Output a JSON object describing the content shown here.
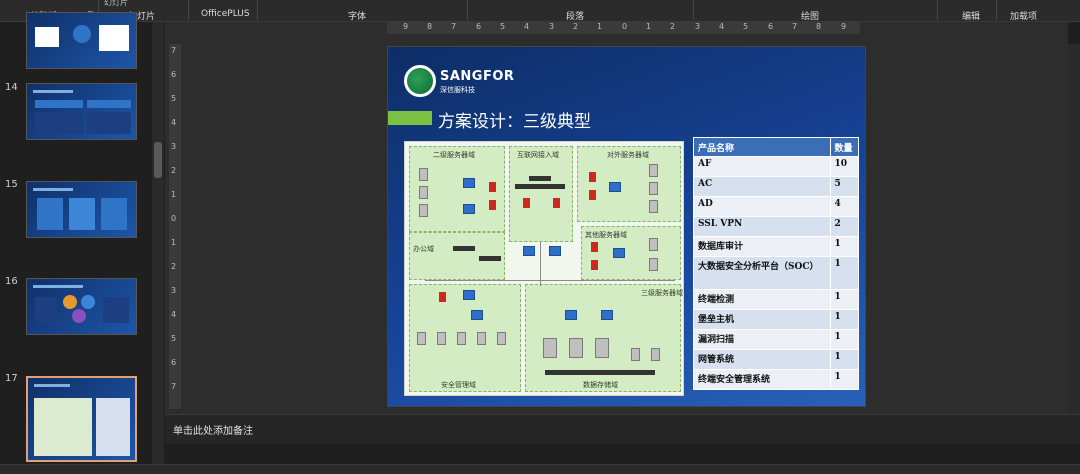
{
  "ribbon": {
    "groups": [
      {
        "key": "clipboard",
        "label": "剪贴板"
      },
      {
        "key": "slides",
        "label": "幻灯片"
      },
      {
        "key": "officeplus",
        "label": "OfficePLUS"
      },
      {
        "key": "font",
        "label": "字体"
      },
      {
        "key": "paragraph",
        "label": "段落"
      },
      {
        "key": "drawing",
        "label": "绘图"
      },
      {
        "key": "edit",
        "label": "编辑"
      },
      {
        "key": "addins",
        "label": "加载项"
      }
    ],
    "top_fragment": "幻灯片"
  },
  "thumbnails": [
    {
      "num": "",
      "selected": false
    },
    {
      "num": "14",
      "selected": false
    },
    {
      "num": "15",
      "selected": false
    },
    {
      "num": "16",
      "selected": false
    },
    {
      "num": "17",
      "selected": true
    }
  ],
  "ruler": {
    "h_ticks": [
      "9",
      "8",
      "7",
      "6",
      "5",
      "4",
      "3",
      "2",
      "1",
      "0",
      "1",
      "2",
      "3",
      "4",
      "5",
      "6",
      "7",
      "8",
      "9"
    ],
    "v_ticks": [
      "7",
      "6",
      "5",
      "4",
      "3",
      "2",
      "1",
      "0",
      "1",
      "2",
      "3",
      "4",
      "5",
      "6",
      "7"
    ]
  },
  "slide": {
    "brand": "SANGFOR",
    "brand_sub": "深信服科技",
    "title": "方案设计：三级典型",
    "diagram_labels": {
      "zone_l2": "二级服务器域",
      "zone_internet": "互联网接入域",
      "zone_external": "对外服务器域",
      "zone_other": "其他服务器域",
      "zone_office": "办公域",
      "zone_l3": "三级服务器域",
      "zone_security": "安全管理域",
      "zone_data": "数据存储域"
    },
    "table": {
      "headers": [
        "产品名称",
        "数量"
      ],
      "rows": [
        {
          "name": "AF",
          "qty": "10"
        },
        {
          "name": "AC",
          "qty": "5"
        },
        {
          "name": "AD",
          "qty": "4"
        },
        {
          "name": "SSL VPN",
          "qty": "2"
        },
        {
          "name": "数据库审计",
          "qty": "1"
        },
        {
          "name": "大数据安全分析平台（SOC）",
          "qty": "1"
        },
        {
          "name": "终端检测",
          "qty": "1"
        },
        {
          "name": "堡垒主机",
          "qty": "1"
        },
        {
          "name": "漏洞扫描",
          "qty": "1"
        },
        {
          "name": "网管系统",
          "qty": "1"
        },
        {
          "name": "终端安全管理系统",
          "qty": "1"
        }
      ]
    }
  },
  "notes": {
    "placeholder": "单击此处添加备注"
  }
}
